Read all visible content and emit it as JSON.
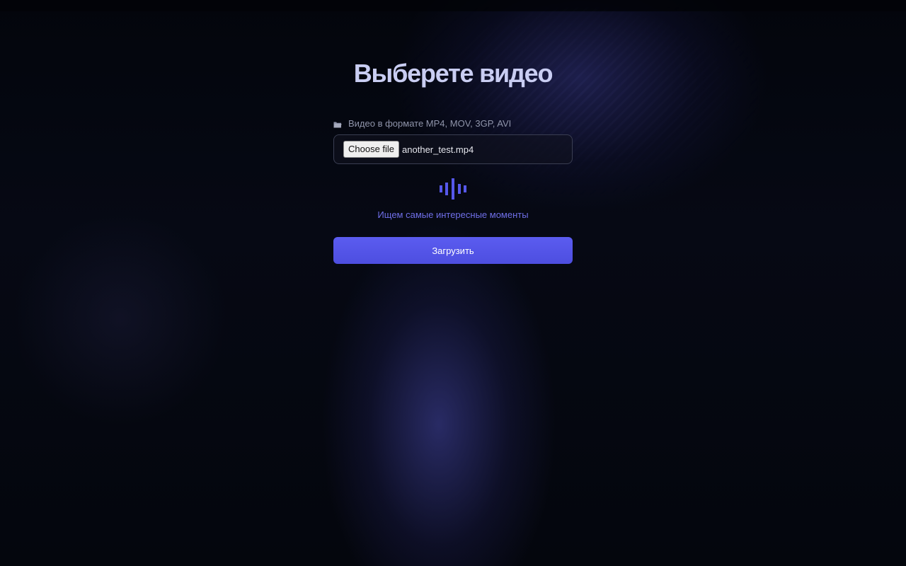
{
  "page": {
    "title": "Выберете видео"
  },
  "upload_form": {
    "field_label": "Видео в формате MP4, MOV, 3GP, AVI",
    "field_icon": "folder-icon",
    "choose_file_label": "Choose file",
    "selected_file": "another_test.mp4",
    "loader_icon": "audio-wave-icon",
    "status_text": "Ищем самые интересные моменты",
    "submit_label": "Загрузить"
  },
  "colors": {
    "accent": "#5658ea",
    "status_text": "#6f6fe8",
    "title": "#c9cdf2",
    "background": "#05070f"
  }
}
